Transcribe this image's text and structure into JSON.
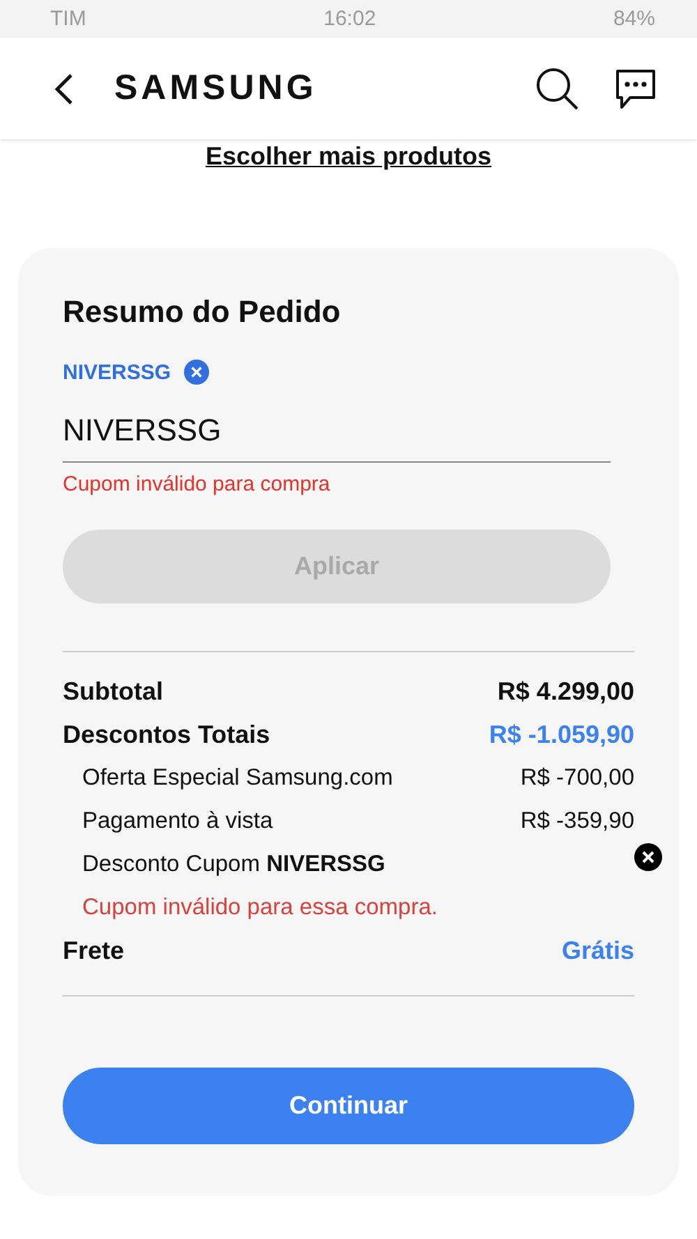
{
  "status_bar": {
    "carrier": "TIM",
    "time": "16:02",
    "battery": "84%"
  },
  "header": {
    "logo": "SAMSUNG"
  },
  "link": "Escolher mais produtos",
  "summary": {
    "title": "Resumo do Pedido",
    "coupon_chip": "NIVERSSG",
    "coupon_input": {
      "value": "NIVERSSG"
    },
    "error": "Cupom inválido para compra",
    "apply_button": {
      "label": "Aplicar",
      "disabled": true
    },
    "rows": [
      {
        "kind": "total",
        "label": "Subtotal",
        "value": "R$ 4.299,00",
        "highlight": false
      },
      {
        "kind": "total",
        "label": "Descontos Totais",
        "value": "R$ -1.059,90",
        "highlight": true
      },
      {
        "kind": "sub",
        "label": "Oferta Especial Samsung.com",
        "value": "R$ -700,00"
      },
      {
        "kind": "sub",
        "label": "Pagamento à vista",
        "value": "R$ -359,90"
      },
      {
        "kind": "coupon",
        "label": "Desconto Cupom **NIVERSSG**",
        "error": "Cupom inválido para essa compra."
      },
      {
        "kind": "total",
        "label": "Frete",
        "value": "Grátis",
        "highlight": true
      }
    ],
    "continue_button": "Continuar"
  }
}
